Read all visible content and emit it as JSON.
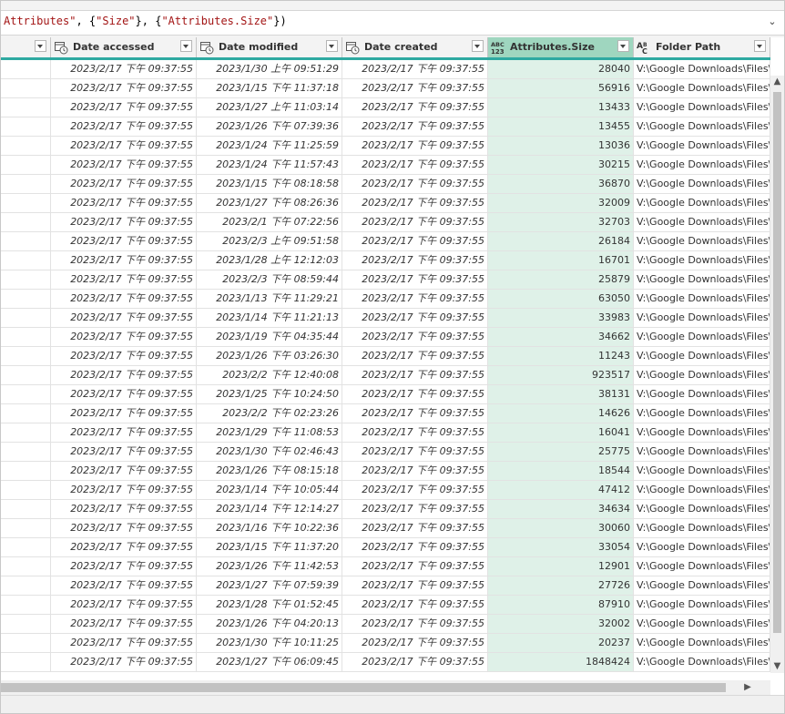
{
  "formula": {
    "parts": [
      {
        "t": "Attributes\"",
        "c": "str"
      },
      {
        "t": ", {",
        "c": ""
      },
      {
        "t": "\"Size\"",
        "c": "str"
      },
      {
        "t": "}, {",
        "c": ""
      },
      {
        "t": "\"Attributes.Size\"",
        "c": "str"
      },
      {
        "t": "})",
        "c": ""
      }
    ]
  },
  "columns": [
    {
      "label": "",
      "icon": "none"
    },
    {
      "label": "Date accessed",
      "icon": "datetime-icon"
    },
    {
      "label": "Date modified",
      "icon": "datetime-icon"
    },
    {
      "label": "Date created",
      "icon": "datetime-icon"
    },
    {
      "label": "Attributes.Size",
      "icon": "any-type-icon",
      "selected": true
    },
    {
      "label": "Folder Path",
      "icon": "text-type-icon"
    }
  ],
  "folder_path": "V:\\Google Downloads\\Files\\",
  "rows": [
    [
      "2023/2/17 下午 09:37:55",
      "2023/1/30 上午 09:51:29",
      "2023/2/17 下午 09:37:55",
      "28040"
    ],
    [
      "2023/2/17 下午 09:37:55",
      "2023/1/15 下午 11:37:18",
      "2023/2/17 下午 09:37:55",
      "56916"
    ],
    [
      "2023/2/17 下午 09:37:55",
      "2023/1/27 上午 11:03:14",
      "2023/2/17 下午 09:37:55",
      "13433"
    ],
    [
      "2023/2/17 下午 09:37:55",
      "2023/1/26 下午 07:39:36",
      "2023/2/17 下午 09:37:55",
      "13455"
    ],
    [
      "2023/2/17 下午 09:37:55",
      "2023/1/24 下午 11:25:59",
      "2023/2/17 下午 09:37:55",
      "13036"
    ],
    [
      "2023/2/17 下午 09:37:55",
      "2023/1/24 下午 11:57:43",
      "2023/2/17 下午 09:37:55",
      "30215"
    ],
    [
      "2023/2/17 下午 09:37:55",
      "2023/1/15 下午 08:18:58",
      "2023/2/17 下午 09:37:55",
      "36870"
    ],
    [
      "2023/2/17 下午 09:37:55",
      "2023/1/27 下午 08:26:36",
      "2023/2/17 下午 09:37:55",
      "32009"
    ],
    [
      "2023/2/17 下午 09:37:55",
      "2023/2/1 下午 07:22:56",
      "2023/2/17 下午 09:37:55",
      "32703"
    ],
    [
      "2023/2/17 下午 09:37:55",
      "2023/2/3 上午 09:51:58",
      "2023/2/17 下午 09:37:55",
      "26184"
    ],
    [
      "2023/2/17 下午 09:37:55",
      "2023/1/28 上午 12:12:03",
      "2023/2/17 下午 09:37:55",
      "16701"
    ],
    [
      "2023/2/17 下午 09:37:55",
      "2023/2/3 下午 08:59:44",
      "2023/2/17 下午 09:37:55",
      "25879"
    ],
    [
      "2023/2/17 下午 09:37:55",
      "2023/1/13 下午 11:29:21",
      "2023/2/17 下午 09:37:55",
      "63050"
    ],
    [
      "2023/2/17 下午 09:37:55",
      "2023/1/14 下午 11:21:13",
      "2023/2/17 下午 09:37:55",
      "33983"
    ],
    [
      "2023/2/17 下午 09:37:55",
      "2023/1/19 下午 04:35:44",
      "2023/2/17 下午 09:37:55",
      "34662"
    ],
    [
      "2023/2/17 下午 09:37:55",
      "2023/1/26 下午 03:26:30",
      "2023/2/17 下午 09:37:55",
      "11243"
    ],
    [
      "2023/2/17 下午 09:37:55",
      "2023/2/2 下午 12:40:08",
      "2023/2/17 下午 09:37:55",
      "923517"
    ],
    [
      "2023/2/17 下午 09:37:55",
      "2023/1/25 下午 10:24:50",
      "2023/2/17 下午 09:37:55",
      "38131"
    ],
    [
      "2023/2/17 下午 09:37:55",
      "2023/2/2 下午 02:23:26",
      "2023/2/17 下午 09:37:55",
      "14626"
    ],
    [
      "2023/2/17 下午 09:37:55",
      "2023/1/29 下午 11:08:53",
      "2023/2/17 下午 09:37:55",
      "16041"
    ],
    [
      "2023/2/17 下午 09:37:55",
      "2023/1/30 下午 02:46:43",
      "2023/2/17 下午 09:37:55",
      "25775"
    ],
    [
      "2023/2/17 下午 09:37:55",
      "2023/1/26 下午 08:15:18",
      "2023/2/17 下午 09:37:55",
      "18544"
    ],
    [
      "2023/2/17 下午 09:37:55",
      "2023/1/14 下午 10:05:44",
      "2023/2/17 下午 09:37:55",
      "47412"
    ],
    [
      "2023/2/17 下午 09:37:55",
      "2023/1/14 下午 12:14:27",
      "2023/2/17 下午 09:37:55",
      "34634"
    ],
    [
      "2023/2/17 下午 09:37:55",
      "2023/1/16 下午 10:22:36",
      "2023/2/17 下午 09:37:55",
      "30060"
    ],
    [
      "2023/2/17 下午 09:37:55",
      "2023/1/15 下午 11:37:20",
      "2023/2/17 下午 09:37:55",
      "33054"
    ],
    [
      "2023/2/17 下午 09:37:55",
      "2023/1/26 下午 11:42:53",
      "2023/2/17 下午 09:37:55",
      "12901"
    ],
    [
      "2023/2/17 下午 09:37:55",
      "2023/1/27 下午 07:59:39",
      "2023/2/17 下午 09:37:55",
      "27726"
    ],
    [
      "2023/2/17 下午 09:37:55",
      "2023/1/28 下午 01:52:45",
      "2023/2/17 下午 09:37:55",
      "87910"
    ],
    [
      "2023/2/17 下午 09:37:55",
      "2023/1/26 下午 04:20:13",
      "2023/2/17 下午 09:37:55",
      "32002"
    ],
    [
      "2023/2/17 下午 09:37:55",
      "2023/1/30 下午 10:11:25",
      "2023/2/17 下午 09:37:55",
      "20237"
    ],
    [
      "2023/2/17 下午 09:37:55",
      "2023/1/27 下午 06:09:45",
      "2023/2/17 下午 09:37:55",
      "1848424"
    ]
  ]
}
